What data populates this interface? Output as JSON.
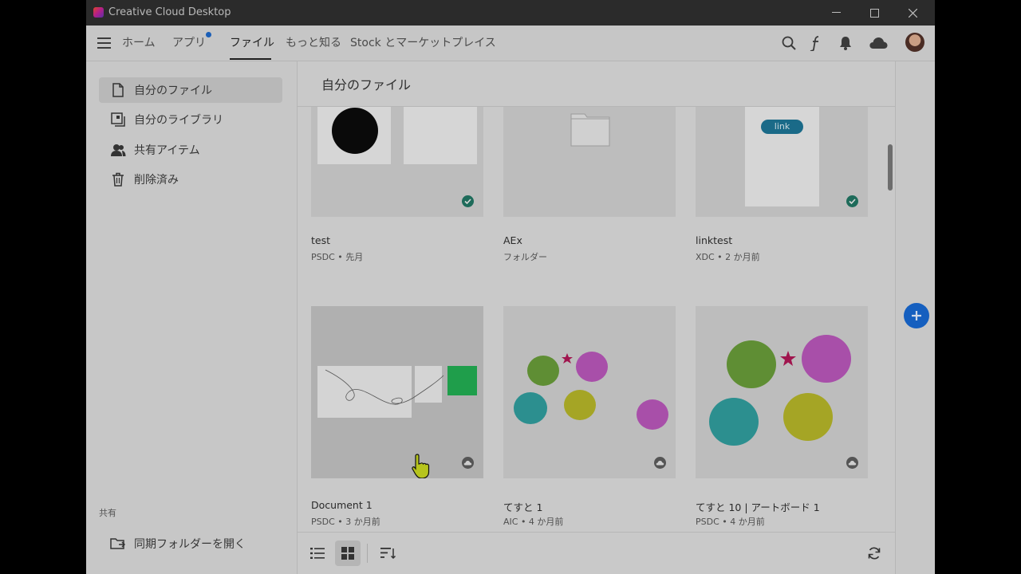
{
  "app": {
    "title": "Creative Cloud Desktop"
  },
  "nav": {
    "tabs": [
      {
        "label": "ホーム"
      },
      {
        "label": "アプリ"
      },
      {
        "label": "ファイル"
      },
      {
        "label": "もっと知る"
      },
      {
        "label": "Stock とマーケットプレイス"
      }
    ],
    "active_tab": "ファイル"
  },
  "sidebar": {
    "items": [
      {
        "label": "自分のファイル",
        "icon": "file-icon"
      },
      {
        "label": "自分のライブラリ",
        "icon": "library-icon"
      },
      {
        "label": "共有アイテム",
        "icon": "shared-users-icon"
      },
      {
        "label": "削除済み",
        "icon": "trash-icon"
      }
    ],
    "section_label": "共有",
    "sync_folder": {
      "label": "同期フォルダーを開く",
      "icon": "folder-open-icon"
    }
  },
  "main": {
    "title": "自分のファイル",
    "files": [
      {
        "name": "test",
        "meta": "PSDC • 先月",
        "status": "synced"
      },
      {
        "name": "AEx",
        "meta": "フォルダー",
        "status": ""
      },
      {
        "name": "linktest",
        "meta": "XDC • 2 か月前",
        "status": "synced",
        "thumb_label": "link"
      },
      {
        "name": "Document 1",
        "meta": "PSDC • 3 か月前",
        "status": "cloud"
      },
      {
        "name": "てすと 1",
        "meta": "AIC • 4 か月前",
        "status": "cloud"
      },
      {
        "name": "てすと 10 | アートボード 1",
        "meta": "PSDC • 4 か月前",
        "status": "cloud"
      }
    ]
  },
  "colors": {
    "accent": "#155fbf",
    "synced": "#1e6b5a"
  }
}
